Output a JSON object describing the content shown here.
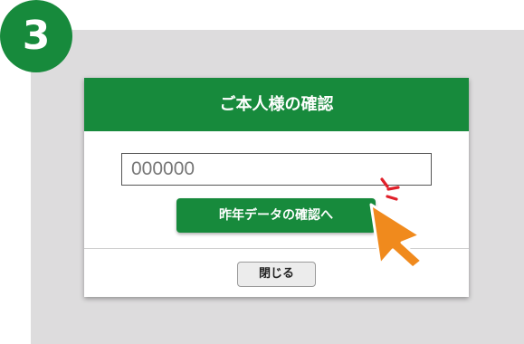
{
  "step": {
    "number": "3"
  },
  "dialog": {
    "title": "ご本人様の確認",
    "input": {
      "value": "000000"
    },
    "confirm_button": "昨年データの確認へ",
    "close_button": "閉じる"
  },
  "colors": {
    "brand_green": "#178a3c",
    "backdrop_gray": "#dddcdd",
    "cursor_orange": "#f08a1d",
    "click_marks_red": "#e0202a"
  },
  "icons": {
    "cursor": "pointer-arrow-icon",
    "click_marks": "click-burst-icon"
  }
}
